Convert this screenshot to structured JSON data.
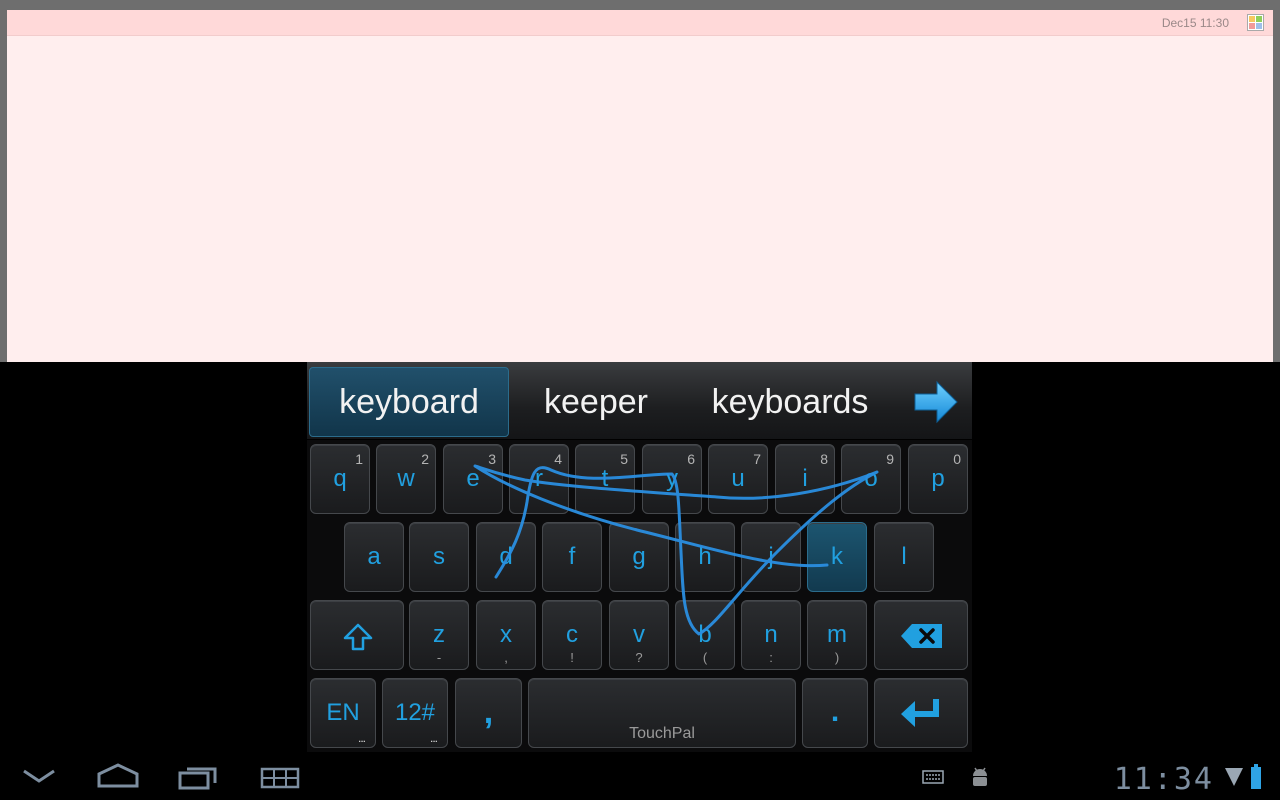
{
  "note": {
    "date": "Dec15 11:30",
    "grid_colors": [
      "#f7c860",
      "#8fcf5a",
      "#f29a9a",
      "#9fbfe9"
    ]
  },
  "suggestions": {
    "items": [
      "keyboard",
      "keeper",
      "keyboards"
    ],
    "selected_index": 0,
    "next_icon": "right-arrow-icon"
  },
  "keyboard": {
    "row1": [
      {
        "main": "q",
        "sup": "1"
      },
      {
        "main": "w",
        "sup": "2"
      },
      {
        "main": "e",
        "sup": "3"
      },
      {
        "main": "r",
        "sup": "4"
      },
      {
        "main": "t",
        "sup": "5"
      },
      {
        "main": "y",
        "sup": "6"
      },
      {
        "main": "u",
        "sup": "7"
      },
      {
        "main": "i",
        "sup": "8"
      },
      {
        "main": "o",
        "sup": "9"
      },
      {
        "main": "p",
        "sup": "0"
      }
    ],
    "row2": [
      {
        "main": "a"
      },
      {
        "main": "s"
      },
      {
        "main": "d"
      },
      {
        "main": "f"
      },
      {
        "main": "g"
      },
      {
        "main": "h"
      },
      {
        "main": "j"
      },
      {
        "main": "k"
      },
      {
        "main": "l"
      }
    ],
    "row3": [
      {
        "main": "z",
        "sub": "-"
      },
      {
        "main": "x",
        "sub": ","
      },
      {
        "main": "c",
        "sub": "!"
      },
      {
        "main": "v",
        "sub": "?"
      },
      {
        "main": "b",
        "sub": "("
      },
      {
        "main": "n",
        "sub": ":"
      },
      {
        "main": "m",
        "sub": ")"
      }
    ],
    "active_key": "k",
    "lang_label": "EN",
    "symbols_label": "12#",
    "comma_label": ",",
    "space_label": "TouchPal",
    "period_label": ".",
    "dots": "...",
    "accent_color": "#21a0e0"
  },
  "system_bar": {
    "clock": "11:34",
    "icons": [
      "back-icon",
      "home-icon",
      "recent-apps-icon",
      "screenshot-icon",
      "keyboard-icon",
      "android-debug-icon",
      "signal-icon",
      "battery-icon"
    ]
  }
}
